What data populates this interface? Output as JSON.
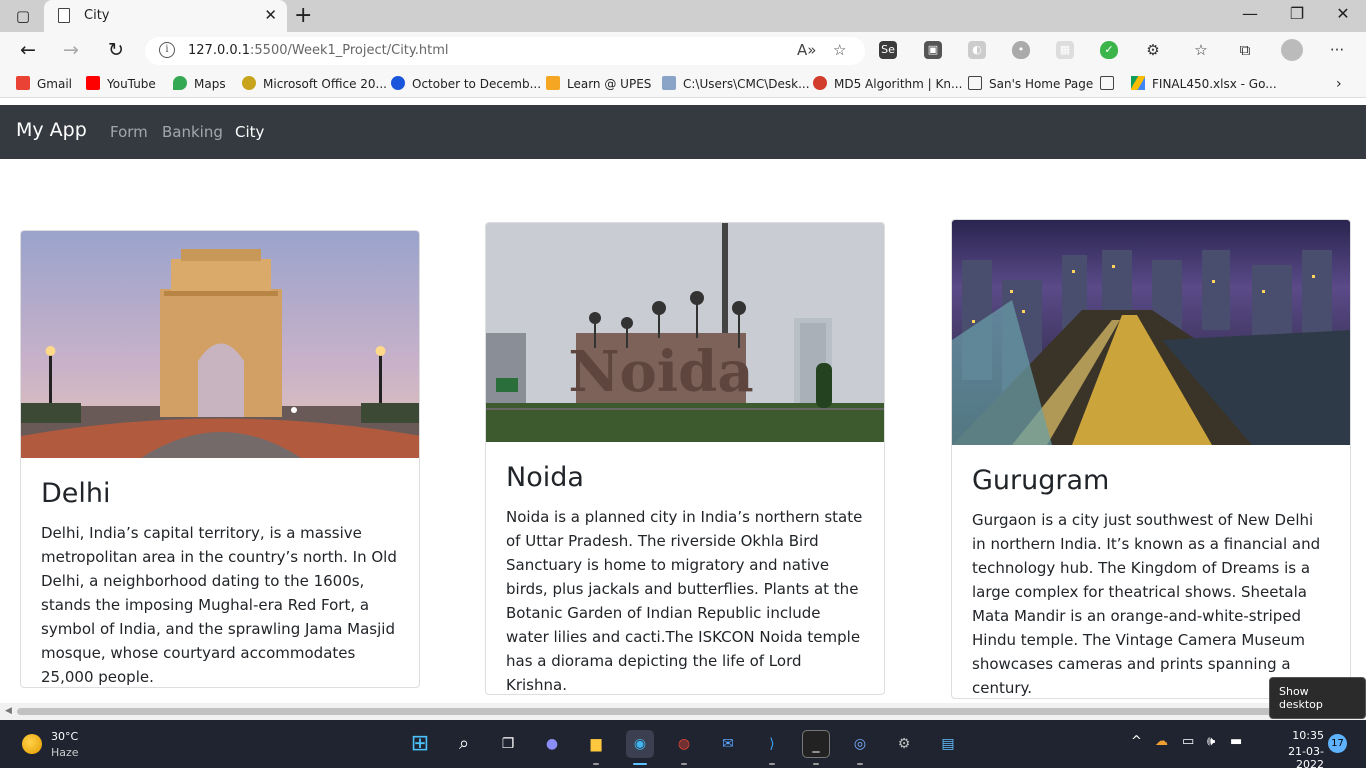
{
  "browser": {
    "tab_title": "City",
    "url_host": "127.0.0.1",
    "url_path": ":5500/Week1_Project/City.html",
    "bookmarks": [
      {
        "label": "Gmail",
        "color": "#ea4335"
      },
      {
        "label": "YouTube",
        "color": "#ff0000"
      },
      {
        "label": "Maps",
        "color": "#34a853"
      },
      {
        "label": "Microsoft Office 20...",
        "color": "#c7a41b"
      },
      {
        "label": "October to Decemb...",
        "color": "#1a56db"
      },
      {
        "label": "Learn @ UPES",
        "color": "#f5a623"
      },
      {
        "label": "C:\\Users\\CMC\\Desk...",
        "color": "#8aa4c8"
      },
      {
        "label": "MD5 Algorithm | Kn...",
        "color": "#d23c2c"
      },
      {
        "label": "San's Home Page",
        "color": "#ffffff"
      },
      {
        "label": "",
        "color": "#ffffff"
      },
      {
        "label": "FINAL450.xlsx - Go...",
        "color": "#fbbc04"
      }
    ]
  },
  "app": {
    "brand": "My App",
    "nav": [
      "Form",
      "Banking",
      "City"
    ],
    "active_nav": "City"
  },
  "cards": [
    {
      "title": "Delhi",
      "text": "Delhi, India’s capital territory, is a massive metropolitan area in the country’s north. In Old Delhi, a neighborhood dating to the 1600s, stands the imposing Mughal-era Red Fort, a symbol of India, and the sprawling Jama Masjid mosque, whose courtyard accommodates 25,000 people."
    },
    {
      "title": "Noida",
      "image_text": "Noida",
      "text": "Noida is a planned city in India’s northern state of Uttar Pradesh. The riverside Okhla Bird Sanctuary is home to migratory and native birds, plus jackals and butterflies. Plants at the Botanic Garden of Indian Republic include water lilies and cacti.The ISKCON Noida temple has a diorama depicting the life of Lord Krishna."
    },
    {
      "title": "Gurugram",
      "text": "Gurgaon is a city just southwest of New Delhi in northern India. It’s known as a financial and technology hub. The Kingdom of Dreams is a large complex for theatrical shows. Sheetala Mata Mandir is an orange-and-white-striped Hindu temple. The Vintage Camera Museum showcases cameras and prints spanning a century."
    }
  ],
  "tooltip": "Show desktop",
  "taskbar": {
    "temperature": "30°C",
    "weather": "Haze",
    "time": "10:35",
    "date": "21-03-2022",
    "notifications": "17"
  }
}
